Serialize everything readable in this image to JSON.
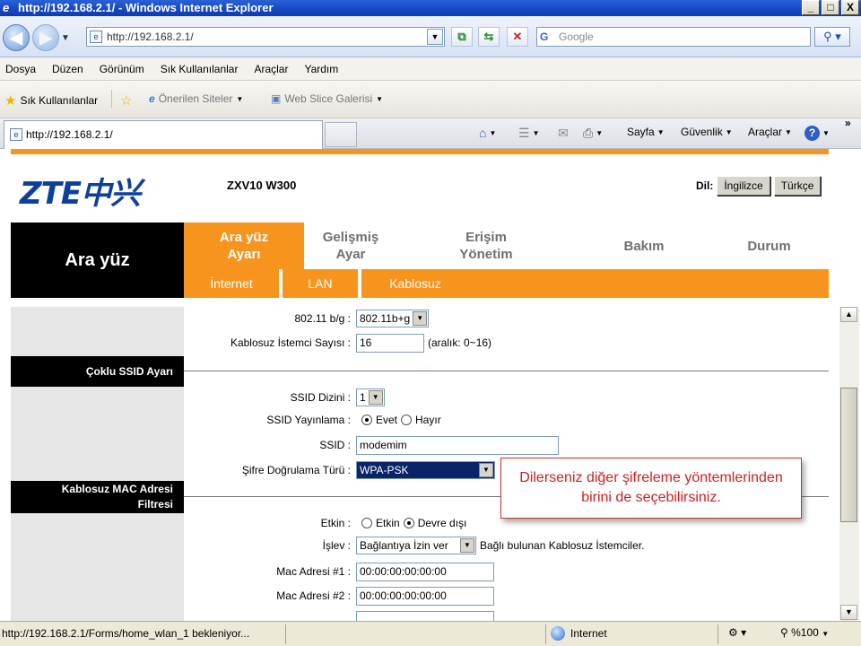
{
  "window": {
    "title": "http://192.168.2.1/ - Windows Internet Explorer",
    "buttons": [
      "_",
      "□",
      "X"
    ]
  },
  "address_bar": {
    "url": "http://192.168.2.1/",
    "search_placeholder": "Google"
  },
  "menu": [
    "Dosya",
    "Düzen",
    "Görünüm",
    "Sık Kullanılanlar",
    "Araçlar",
    "Yardım"
  ],
  "favorites_bar": {
    "favorites_label": "Sık Kullanılanlar",
    "suggested_sites": "Önerilen Siteler",
    "web_slice": "Web Slice Galerisi"
  },
  "tab": {
    "title": "http://192.168.2.1/"
  },
  "command_bar": {
    "page": "Sayfa",
    "safety": "Güvenlik",
    "tools": "Araçlar",
    "chevron": "»"
  },
  "router": {
    "logo": "ZTE中兴",
    "model": "ZXV10 W300",
    "language_label": "Dil:",
    "lang_english": "İngilizce",
    "lang_turkish": "Türkçe",
    "section_title": "Ara yüz",
    "nav_tabs": [
      {
        "label": "Ara yüz\nAyarı",
        "active": true
      },
      {
        "label": "Gelişmiş\nAyar",
        "active": false
      },
      {
        "label": "Erişim\nYönetim",
        "active": false
      },
      {
        "label": "Bakım",
        "active": false
      },
      {
        "label": "Durum",
        "active": false
      }
    ],
    "sub_tabs": [
      "İnternet",
      "LAN",
      "Kablosuz"
    ]
  },
  "form": {
    "mode_label": "802.11 b/g :",
    "mode_value": "802.11b+g",
    "clients_label": "Kablosuz İstemci Sayısı :",
    "clients_value": "16",
    "clients_hint": "(aralık: 0~16)",
    "multi_ssid_heading": "Çoklu SSID Ayarı",
    "ssid_index_label": "SSID Dizini :",
    "ssid_index_value": "1",
    "ssid_broadcast_label": "SSID Yayınlama :",
    "yes": "Evet",
    "no": "Hayır",
    "ssid_label": "SSID :",
    "ssid_value": "modemim",
    "auth_label": "Şifre Doğrulama Türü :",
    "auth_value": "WPA-PSK",
    "mac_filter_heading_1": "Kablosuz MAC Adresi",
    "mac_filter_heading_2": "Filtresi",
    "enabled_label": "Etkin :",
    "enabled": "Etkin",
    "disabled": "Devre dışı",
    "function_label": "İşlev :",
    "function_value": "Bağlantıya İzin ver",
    "function_suffix": "Bağlı bulunan Kablosuz İstemciler.",
    "mac1_label": "Mac Adresi #1 :",
    "mac1_value": "00:00:00:00:00:00",
    "mac2_label": "Mac Adresi #2 :",
    "mac2_value": "00:00:00:00:00:00"
  },
  "callout": {
    "line1": "Dilerseniz diğer şifreleme yöntemlerinden",
    "line2": "birini de seçebilirsiniz."
  },
  "status_bar": {
    "text": "http://192.168.2.1/Forms/home_wlan_1 bekleniyor...",
    "zone": "Internet",
    "zoom": "%100"
  }
}
